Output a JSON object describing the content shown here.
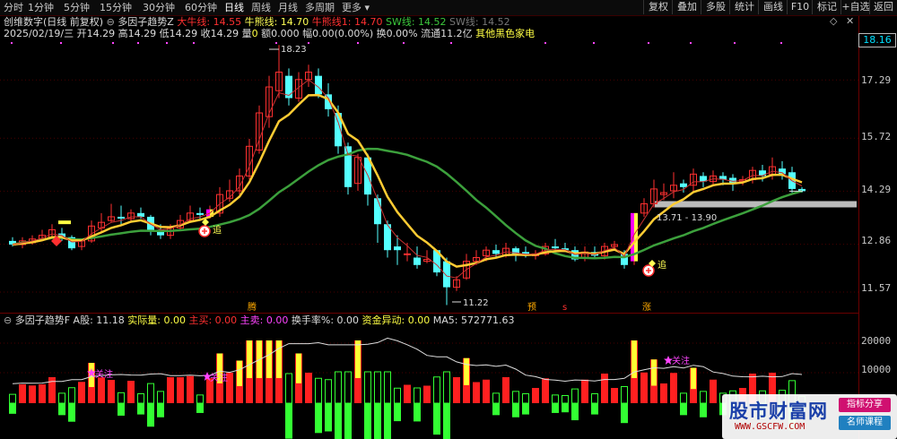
{
  "toolbar": {
    "periods": [
      "分时",
      "1分钟",
      "5分钟",
      "15分钟",
      "30分钟",
      "60分钟",
      "日线",
      "周线",
      "月线",
      "多周期",
      "更多"
    ],
    "active_period": "日线",
    "buttons": [
      "复权",
      "叠加",
      "多股",
      "统计",
      "画线",
      "F10",
      "标记",
      "+自选",
      "返回"
    ]
  },
  "header": {
    "title": "创维数字(日线 前复权)",
    "indicator": "多因子趋势Z",
    "ind_values": [
      {
        "label": "大牛线:",
        "value": "14.55",
        "color": "#ff3030"
      },
      {
        "label": "牛熊线:",
        "value": "14.70",
        "color": "#ffff55"
      },
      {
        "label": "牛熊线1:",
        "value": "14.70",
        "color": "#ff3030"
      },
      {
        "label": "SW线:",
        "value": "14.52",
        "color": "#3cc83c"
      },
      {
        "label": "SW线:",
        "value": "14.52",
        "color": "#777777"
      }
    ]
  },
  "info": {
    "date": "2025/02/19/三",
    "open_label": "开",
    "open": "14.29",
    "high_label": "高",
    "high": "14.29",
    "low_label": "低",
    "low": "14.29",
    "close_label": "收",
    "close": "14.29",
    "vol_label": "量",
    "vol": "0",
    "amt_label": "额",
    "amt": "0.000",
    "chg_label": "幅",
    "chg": "0.00(0.00%)",
    "turn_label": "换",
    "turn": "0.00%",
    "float_label": "流通",
    "float": "11.2亿",
    "sector": "其他黑色家电"
  },
  "axis": {
    "price_ticks": [
      "17.29",
      "15.72",
      "14.29",
      "12.86",
      "11.57"
    ],
    "current_price": "18.16",
    "vol_ticks": [
      "20000",
      "10000"
    ]
  },
  "annotations": {
    "high": "18.23",
    "low": "11.22",
    "range": "13.71 - 13.90",
    "zhui": "追",
    "guanzhu": "关注",
    "markers": [
      "腾",
      "预",
      "s",
      "涨"
    ]
  },
  "sub": {
    "indicator": "多因子趋势F",
    "items": [
      {
        "label": "A股:",
        "value": "11.18",
        "color": "#dddddd"
      },
      {
        "label": "实际量:",
        "value": "0.00",
        "color": "#ffff44"
      },
      {
        "label": "主买:",
        "value": "0.00",
        "color": "#ff3030"
      },
      {
        "label": "主卖:",
        "value": "0.00",
        "color": "#ff44ff"
      },
      {
        "label": "换手率%:",
        "value": "0.00",
        "color": "#dddddd"
      },
      {
        "label": "资金异动:",
        "value": "0.00",
        "color": "#ffff44"
      },
      {
        "label": "MA5:",
        "value": "572771.63",
        "color": "#dddddd"
      }
    ]
  },
  "watermark": {
    "logo": "股市财富网",
    "url": "WWW.GSCFW.COM",
    "tag1": "指标分享",
    "tag2": "名师课程"
  },
  "chart_data": {
    "type": "candlestick",
    "y_axis_ticks": [
      17.29,
      15.72,
      14.29,
      12.86,
      11.57
    ],
    "candles": [
      [
        12.95,
        12.85,
        13.05,
        12.8
      ],
      [
        12.85,
        12.95,
        13.05,
        12.75
      ],
      [
        12.9,
        13.0,
        13.1,
        12.85
      ],
      [
        13.0,
        13.1,
        13.25,
        12.95
      ],
      [
        13.05,
        13.25,
        13.4,
        13.0
      ],
      [
        13.15,
        13.05,
        13.3,
        12.95
      ],
      [
        13.05,
        12.75,
        13.1,
        12.7
      ],
      [
        12.8,
        12.95,
        13.0,
        12.7
      ],
      [
        12.95,
        13.35,
        13.5,
        12.9
      ],
      [
        13.3,
        13.45,
        13.7,
        13.2
      ],
      [
        13.5,
        13.6,
        13.95,
        13.45
      ],
      [
        13.6,
        13.55,
        13.9,
        13.4
      ],
      [
        13.55,
        13.7,
        13.8,
        13.45
      ],
      [
        13.7,
        13.6,
        13.85,
        13.55
      ],
      [
        13.6,
        13.2,
        13.65,
        13.1
      ],
      [
        13.25,
        13.1,
        13.4,
        13.0
      ],
      [
        13.1,
        13.3,
        13.4,
        13.0
      ],
      [
        13.3,
        13.5,
        13.65,
        13.25
      ],
      [
        13.5,
        13.7,
        13.9,
        13.45
      ],
      [
        13.7,
        13.65,
        13.85,
        13.55
      ],
      [
        13.6,
        13.8,
        13.9,
        13.55
      ],
      [
        13.7,
        14.2,
        14.4,
        13.6
      ],
      [
        14.1,
        14.3,
        14.6,
        14.0
      ],
      [
        14.3,
        14.7,
        14.9,
        14.2
      ],
      [
        14.7,
        15.5,
        15.7,
        14.6
      ],
      [
        15.4,
        16.4,
        16.6,
        15.3
      ],
      [
        16.3,
        17.1,
        17.4,
        16.0
      ],
      [
        17.0,
        17.5,
        18.23,
        16.8
      ],
      [
        17.4,
        16.8,
        17.6,
        16.6
      ],
      [
        16.8,
        17.3,
        17.5,
        16.7
      ],
      [
        17.3,
        17.5,
        17.7,
        17.1
      ],
      [
        17.4,
        16.9,
        17.6,
        16.8
      ],
      [
        16.9,
        16.5,
        17.2,
        16.3
      ],
      [
        16.4,
        15.5,
        16.6,
        15.3
      ],
      [
        15.5,
        14.4,
        15.6,
        14.2
      ],
      [
        14.5,
        15.2,
        15.3,
        14.3
      ],
      [
        15.2,
        14.2,
        15.3,
        13.9
      ],
      [
        14.1,
        13.4,
        14.2,
        12.9
      ],
      [
        13.4,
        12.7,
        13.5,
        12.5
      ],
      [
        12.8,
        12.7,
        13.1,
        12.3
      ],
      [
        12.6,
        12.6,
        12.9,
        12.4
      ],
      [
        12.5,
        12.3,
        12.8,
        12.2
      ],
      [
        12.4,
        12.45,
        12.7,
        12.35
      ],
      [
        12.7,
        12.1,
        12.7,
        12.0
      ],
      [
        12.4,
        11.7,
        12.5,
        11.22
      ],
      [
        11.7,
        11.9,
        12.0,
        11.6
      ],
      [
        11.95,
        12.4,
        12.6,
        11.9
      ],
      [
        12.4,
        12.5,
        12.7,
        12.3
      ],
      [
        12.55,
        12.7,
        12.8,
        12.4
      ],
      [
        12.7,
        12.6,
        12.85,
        12.5
      ],
      [
        12.55,
        12.75,
        12.9,
        12.5
      ],
      [
        12.75,
        12.6,
        12.8,
        12.4
      ],
      [
        12.65,
        12.55,
        12.8,
        12.5
      ],
      [
        12.55,
        12.6,
        12.7,
        12.45
      ],
      [
        12.6,
        12.8,
        12.9,
        12.55
      ],
      [
        12.8,
        12.75,
        13.0,
        12.7
      ],
      [
        12.75,
        12.7,
        12.9,
        12.65
      ],
      [
        12.7,
        12.45,
        12.8,
        12.4
      ],
      [
        12.5,
        12.65,
        12.8,
        12.4
      ],
      [
        12.65,
        12.55,
        12.8,
        12.5
      ],
      [
        12.55,
        12.8,
        12.9,
        12.45
      ],
      [
        12.8,
        12.85,
        12.95,
        12.7
      ],
      [
        12.6,
        12.3,
        12.7,
        12.2
      ],
      [
        12.4,
        13.7,
        13.7,
        12.3
      ],
      [
        13.7,
        13.95,
        14.1,
        13.6
      ],
      [
        13.95,
        14.35,
        14.6,
        13.85
      ],
      [
        14.2,
        14.25,
        14.5,
        14.05
      ],
      [
        14.3,
        14.45,
        14.8,
        14.1
      ],
      [
        14.5,
        14.4,
        14.6,
        14.25
      ],
      [
        14.45,
        14.75,
        14.9,
        14.3
      ],
      [
        14.7,
        14.55,
        14.8,
        14.4
      ],
      [
        14.55,
        14.7,
        14.85,
        14.45
      ],
      [
        14.7,
        14.6,
        14.8,
        14.45
      ],
      [
        14.65,
        14.5,
        14.75,
        14.3
      ],
      [
        14.55,
        14.6,
        14.7,
        14.45
      ],
      [
        14.6,
        14.85,
        14.95,
        14.5
      ],
      [
        14.85,
        14.7,
        15.0,
        14.55
      ],
      [
        14.75,
        14.95,
        15.2,
        14.6
      ],
      [
        14.9,
        14.75,
        15.1,
        14.6
      ],
      [
        14.8,
        14.35,
        14.95,
        14.25
      ],
      [
        14.35,
        14.29,
        14.4,
        14.25
      ]
    ]
  }
}
